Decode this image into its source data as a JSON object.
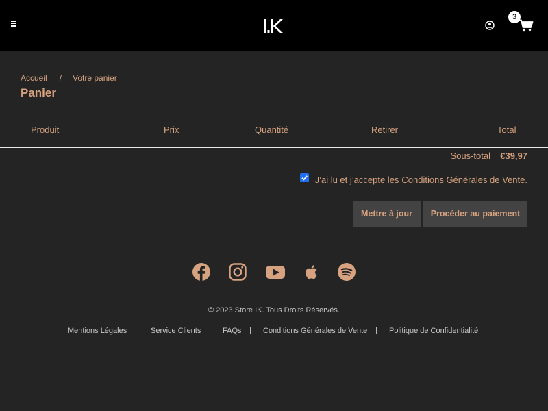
{
  "header": {
    "logo_text": "IK",
    "cart_count": "3",
    "icons": {
      "menu": "hamburger-menu-icon",
      "account": "user-account-icon",
      "cart": "shopping-cart-icon"
    }
  },
  "breadcrumb": {
    "home": "Accueil",
    "separator": "/",
    "current": "Votre panier"
  },
  "page_title": "Panier",
  "cart_table": {
    "headers": [
      "Produit",
      "Prix",
      "Quantité",
      "Retirer",
      "Total"
    ]
  },
  "summary": {
    "subtotal_label": "Sous-total",
    "subtotal_value": "€39,97"
  },
  "terms": {
    "checked": true,
    "text": "J’ai lu et j’accepte les",
    "link": "Conditions Générales de Vente."
  },
  "buttons": {
    "update": "Mettre à jour",
    "checkout": "Procéder au paiement"
  },
  "social": [
    "facebook-icon",
    "instagram-icon",
    "youtube-icon",
    "apple-icon",
    "spotify-icon"
  ],
  "footer": {
    "copyright": "© 2023 Store IK. Tous Droits Réservés.",
    "separator": "|",
    "links": [
      "Mentions Légales",
      "Service Clients",
      "FAQs",
      "Conditions Générales de Vente",
      "Politique de Confidentialité"
    ]
  },
  "colors": {
    "accent": "#d6a27f",
    "header_bg": "#000000",
    "page_bg": "#242424",
    "button_bg": "#434343",
    "checkbox": "#1f6ff0"
  }
}
